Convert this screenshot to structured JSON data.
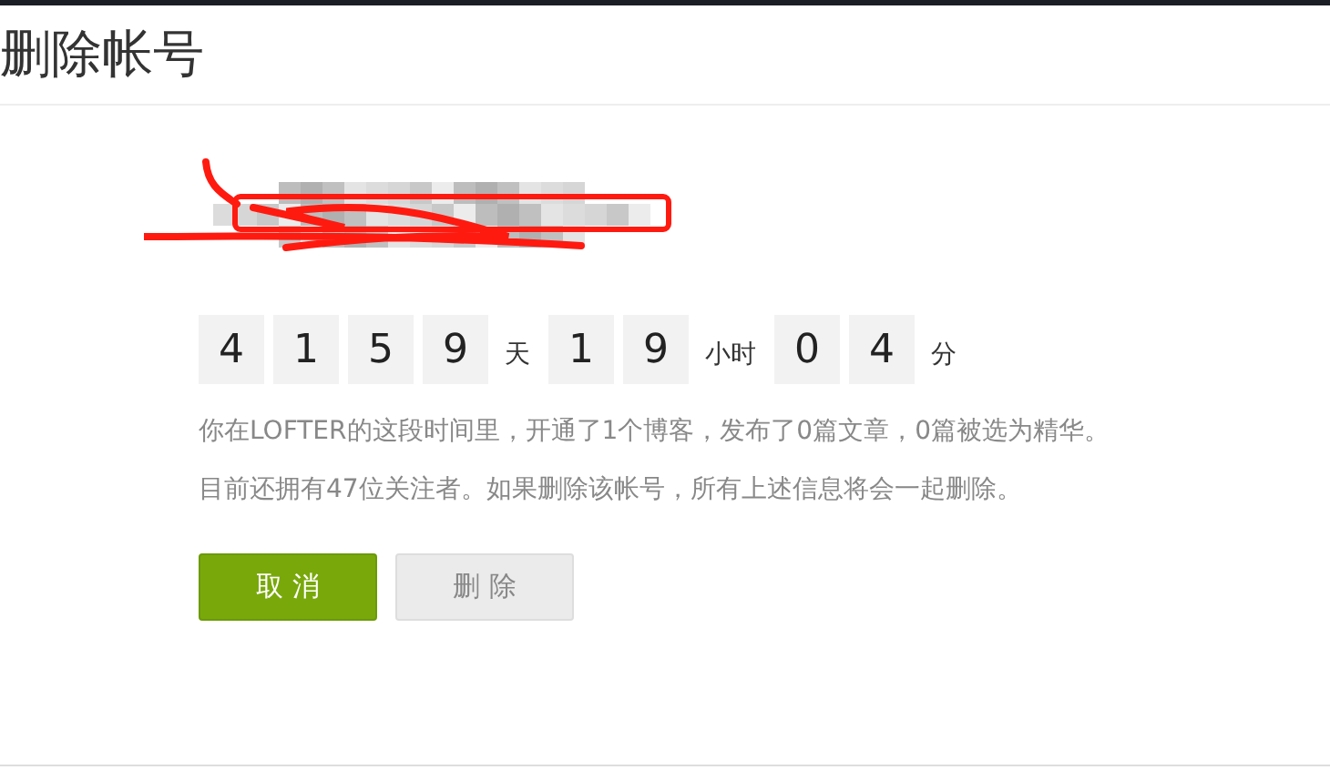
{
  "page_title": "删除帐号",
  "countdown": [
    {
      "digits": [
        "4",
        "1",
        "5",
        "9"
      ],
      "unit": "天"
    },
    {
      "digits": [
        "1",
        "9"
      ],
      "unit": "小时"
    },
    {
      "digits": [
        "0",
        "4"
      ],
      "unit": "分"
    }
  ],
  "summary_lines": [
    "你在LOFTER的这段时间里，开通了1个博客，发布了0篇文章，0篇被选为精华。",
    "目前还拥有47位关注者。如果删除该帐号，所有上述信息将会一起删除。"
  ],
  "buttons": [
    {
      "label": "取 消",
      "kind": "primary"
    },
    {
      "label": "删 除",
      "kind": "secondary"
    }
  ]
}
